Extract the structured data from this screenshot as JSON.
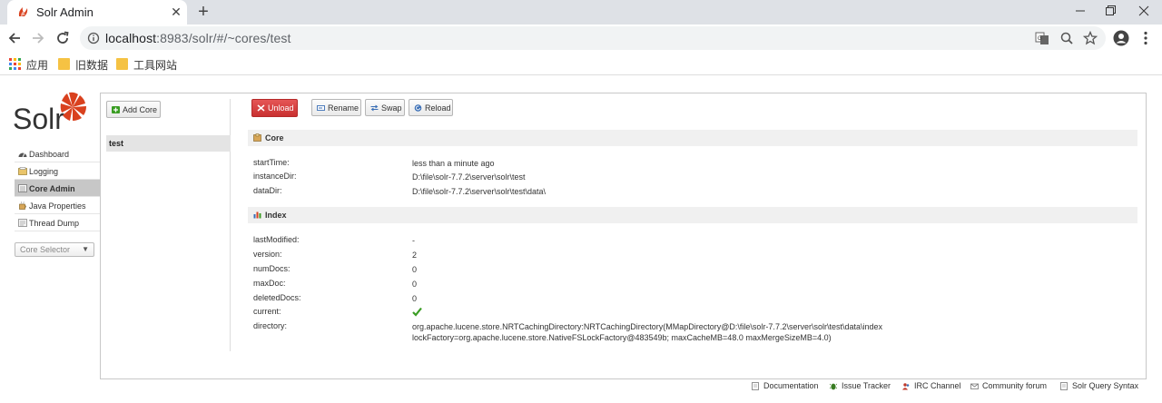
{
  "browser": {
    "tab_title": "Solr Admin",
    "new_tab_label": "+",
    "close_label": "✕",
    "url_host": "localhost",
    "url_path": ":8983/solr/#/~cores/test",
    "bookmarks": [
      {
        "label": "应用"
      },
      {
        "label": "旧数据"
      },
      {
        "label": "工具网站"
      }
    ]
  },
  "solr": {
    "logo_text": "Solr",
    "nav": [
      {
        "label": "Dashboard"
      },
      {
        "label": "Logging"
      },
      {
        "label": "Core Admin"
      },
      {
        "label": "Java Properties"
      },
      {
        "label": "Thread Dump"
      }
    ],
    "core_selector": "Core Selector",
    "add_core": "Add Core",
    "cores": [
      "test"
    ],
    "buttons": {
      "unload": "Unload",
      "rename": "Rename",
      "swap": "Swap",
      "reload": "Reload"
    },
    "core_section": {
      "title": "Core",
      "rows": [
        {
          "key": "startTime:",
          "value": "less than a minute ago"
        },
        {
          "key": "instanceDir:",
          "value": "D:\\file\\solr-7.7.2\\server\\solr\\test"
        },
        {
          "key": "dataDir:",
          "value": "D:\\file\\solr-7.7.2\\server\\solr\\test\\data\\"
        }
      ]
    },
    "index_section": {
      "title": "Index",
      "rows": [
        {
          "key": "lastModified:",
          "value": "-"
        },
        {
          "key": "version:",
          "value": "2"
        },
        {
          "key": "numDocs:",
          "value": "0"
        },
        {
          "key": "maxDoc:",
          "value": "0"
        },
        {
          "key": "deletedDocs:",
          "value": "0"
        },
        {
          "key": "current:",
          "value": "✔"
        }
      ],
      "directory_key": "directory:",
      "directory_line1": "org.apache.lucene.store.NRTCachingDirectory:NRTCachingDirectory(MMapDirectory@D:\\file\\solr-7.7.2\\server\\solr\\test\\data\\index",
      "directory_line2": "lockFactory=org.apache.lucene.store.NativeFSLockFactory@483549b; maxCacheMB=48.0 maxMergeSizeMB=4.0)"
    },
    "footer": [
      {
        "label": "Documentation"
      },
      {
        "label": "Issue Tracker"
      },
      {
        "label": "IRC Channel"
      },
      {
        "label": "Community forum"
      },
      {
        "label": "Solr Query Syntax"
      }
    ],
    "colors": {
      "solr_red": "#d9411e",
      "unload_red": "#c93030",
      "check_green": "#3a9d23"
    }
  }
}
